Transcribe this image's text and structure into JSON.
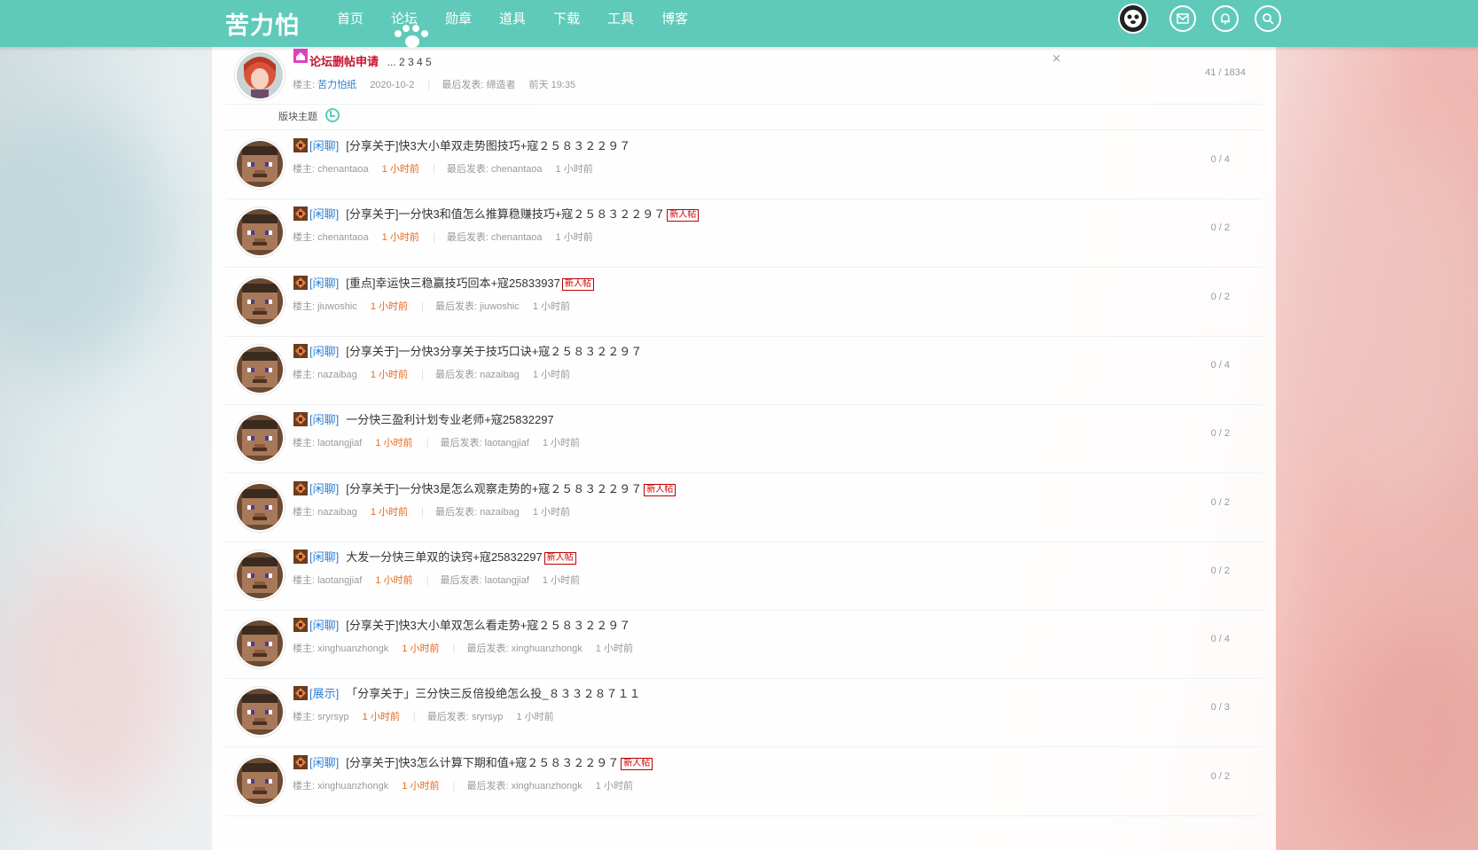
{
  "header": {
    "logo": "苦力怕",
    "nav": [
      "首页",
      "论坛",
      "勋章",
      "道具",
      "下载",
      "工具",
      "博客"
    ],
    "icons": [
      "avatar",
      "mail-icon",
      "bell-icon",
      "search-icon"
    ]
  },
  "sticky": {
    "title": "论坛删帖申请",
    "pages": "... 2  3  4  5",
    "owner_label": "楼主:",
    "owner": "苦力怕纸",
    "date": "2020-10-2",
    "last_label": "最后发表:",
    "last_poster": "缔造者",
    "last_time": "前天 19:35",
    "stats": "41 / 1834",
    "close": "×"
  },
  "section_label": "版块主题",
  "threads": [
    {
      "cat": "[闲聊]",
      "title": "[分享关于]快3大小单双走势图技巧+寇２５８３２２９７",
      "new": "",
      "owner": "chenantaoa",
      "time": "1 小时前",
      "last": "chenantaoa",
      "last_time": "1 小时前",
      "stats": "0 / 4"
    },
    {
      "cat": "[闲聊]",
      "title": "[分享关于]一分快3和值怎么推算稳赚技巧+寇２５８３２２９７",
      "new": "新人帖",
      "owner": "chenantaoa",
      "time": "1 小时前",
      "last": "chenantaoa",
      "last_time": "1 小时前",
      "stats": "0 / 2"
    },
    {
      "cat": "[闲聊]",
      "title": "[重点]幸运快三稳赢技巧回本+寇25833937",
      "new": "新人帖",
      "owner": "jiuwoshic",
      "time": "1 小时前",
      "last": "jiuwoshic",
      "last_time": "1 小时前",
      "stats": "0 / 2"
    },
    {
      "cat": "[闲聊]",
      "title": "[分享关于]一分快3分享关于技巧口诀+寇２５８３２２９７",
      "new": "",
      "owner": "nazaibag",
      "time": "1 小时前",
      "last": "nazaibag",
      "last_time": "1 小时前",
      "stats": "0 / 4"
    },
    {
      "cat": "[闲聊]",
      "title": "一分快三盈利计划专业老师+寇25832297",
      "new": "",
      "owner": "laotangjiaf",
      "time": "1 小时前",
      "last": "laotangjiaf",
      "last_time": "1 小时前",
      "stats": "0 / 2"
    },
    {
      "cat": "[闲聊]",
      "title": "[分享关于]一分快3是怎么观察走势的+寇２５８３２２９７",
      "new": "新人帖",
      "owner": "nazaibag",
      "time": "1 小时前",
      "last": "nazaibag",
      "last_time": "1 小时前",
      "stats": "0 / 2"
    },
    {
      "cat": "[闲聊]",
      "title": "大发一分快三单双的诀窍+寇25832297",
      "new": "新人帖",
      "owner": "laotangjiaf",
      "time": "1 小时前",
      "last": "laotangjiaf",
      "last_time": "1 小时前",
      "stats": "0 / 2"
    },
    {
      "cat": "[闲聊]",
      "title": "[分享关于]快3大小单双怎么看走势+寇２５８３２２９７",
      "new": "",
      "owner": "xinghuanzhongk",
      "time": "1 小时前",
      "last": "xinghuanzhongk",
      "last_time": "1 小时前",
      "stats": "0 / 4"
    },
    {
      "cat": "[展示]",
      "title": "「分享关于」三分快三反倍投绝怎么投_８３３２８７１１",
      "new": "",
      "owner": "sryrsyp",
      "time": "1 小时前",
      "last": "sryrsyp",
      "last_time": "1 小时前",
      "stats": "0 / 3"
    },
    {
      "cat": "[闲聊]",
      "title": "[分享关于]快3怎么计算下期和值+寇２５８３２２９７",
      "new": "新人帖",
      "owner": "xinghuanzhongk",
      "time": "1 小时前",
      "last": "xinghuanzhongk",
      "last_time": "1 小时前",
      "stats": "0 / 2"
    }
  ],
  "labels": {
    "owner": "楼主:",
    "last": "最后发表:"
  }
}
